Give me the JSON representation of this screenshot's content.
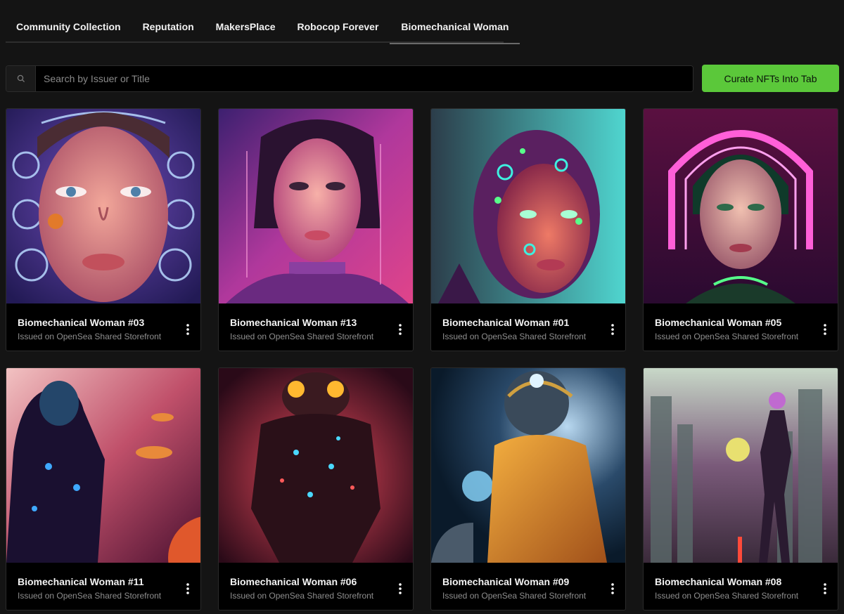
{
  "tabs": [
    {
      "label": "Community Collection",
      "active": false
    },
    {
      "label": "Reputation",
      "active": false
    },
    {
      "label": "MakersPlace",
      "active": false
    },
    {
      "label": "Robocop Forever",
      "active": false
    },
    {
      "label": "Biomechanical Woman",
      "active": true
    }
  ],
  "search": {
    "placeholder": "Search by Issuer or Title",
    "icon": "search-icon"
  },
  "curate_button": {
    "label": "Curate NFTs Into Tab",
    "color": "#5bc83a"
  },
  "cards": [
    {
      "title": "Biomechanical Woman #03",
      "issuer": "Issued on OpenSea Shared Storefront"
    },
    {
      "title": "Biomechanical Woman #13",
      "issuer": "Issued on OpenSea Shared Storefront"
    },
    {
      "title": "Biomechanical Woman #01",
      "issuer": "Issued on OpenSea Shared Storefront"
    },
    {
      "title": "Biomechanical Woman #05",
      "issuer": "Issued on OpenSea Shared Storefront"
    },
    {
      "title": "Biomechanical Woman #11",
      "issuer": "Issued on OpenSea Shared Storefront"
    },
    {
      "title": "Biomechanical Woman #06",
      "issuer": "Issued on OpenSea Shared Storefront"
    },
    {
      "title": "Biomechanical Woman #09",
      "issuer": "Issued on OpenSea Shared Storefront"
    },
    {
      "title": "Biomechanical Woman #08",
      "issuer": "Issued on OpenSea Shared Storefront"
    }
  ],
  "colors": {
    "background": "#141414",
    "card": "#000000",
    "accent": "#5bc83a"
  }
}
